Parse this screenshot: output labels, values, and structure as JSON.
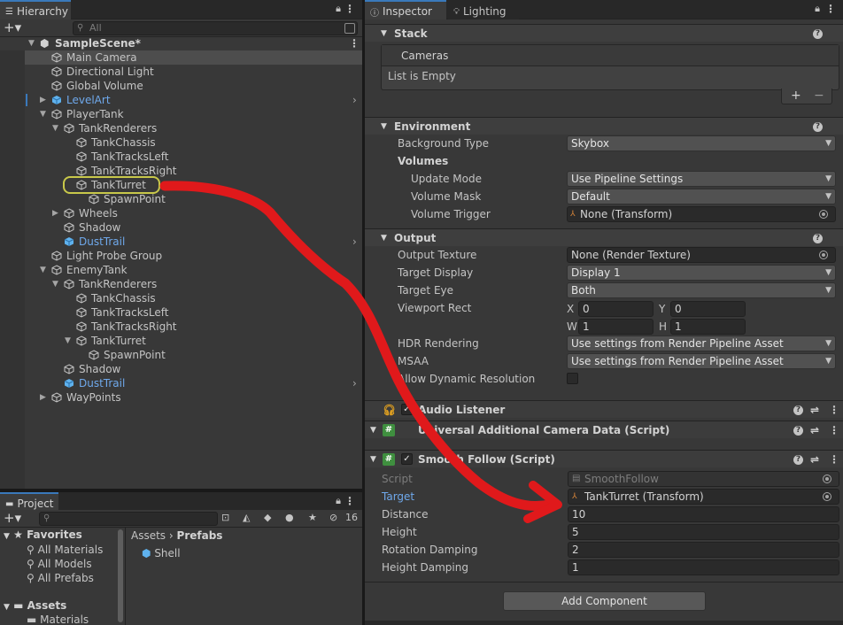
{
  "hierarchy": {
    "tab": "Hierarchy",
    "search_placeholder": "All",
    "scene": "SampleScene*",
    "rows": [
      {
        "label": "Main Camera",
        "depth": 1,
        "arrow": "",
        "blue": false,
        "selected": true
      },
      {
        "label": "Directional Light",
        "depth": 1,
        "arrow": "",
        "blue": false
      },
      {
        "label": "Global Volume",
        "depth": 1,
        "arrow": "",
        "blue": false
      },
      {
        "label": "LevelArt",
        "depth": 1,
        "arrow": "right",
        "blue": true,
        "more": true
      },
      {
        "label": "PlayerTank",
        "depth": 1,
        "arrow": "down",
        "blue": false
      },
      {
        "label": "TankRenderers",
        "depth": 2,
        "arrow": "down",
        "blue": false
      },
      {
        "label": "TankChassis",
        "depth": 3,
        "arrow": "",
        "blue": false
      },
      {
        "label": "TankTracksLeft",
        "depth": 3,
        "arrow": "",
        "blue": false
      },
      {
        "label": "TankTracksRight",
        "depth": 3,
        "arrow": "",
        "blue": false
      },
      {
        "label": "TankTurret",
        "depth": 3,
        "arrow": "",
        "blue": false,
        "circled": true
      },
      {
        "label": "SpawnPoint",
        "depth": 4,
        "arrow": "",
        "blue": false
      },
      {
        "label": "Wheels",
        "depth": 2,
        "arrow": "right",
        "blue": false
      },
      {
        "label": "Shadow",
        "depth": 2,
        "arrow": "",
        "blue": false
      },
      {
        "label": "DustTrail",
        "depth": 2,
        "arrow": "",
        "blue": true,
        "more": true
      },
      {
        "label": "Light Probe Group",
        "depth": 1,
        "arrow": "",
        "blue": false
      },
      {
        "label": "EnemyTank",
        "depth": 1,
        "arrow": "down",
        "blue": false
      },
      {
        "label": "TankRenderers",
        "depth": 2,
        "arrow": "down",
        "blue": false
      },
      {
        "label": "TankChassis",
        "depth": 3,
        "arrow": "",
        "blue": false
      },
      {
        "label": "TankTracksLeft",
        "depth": 3,
        "arrow": "",
        "blue": false
      },
      {
        "label": "TankTracksRight",
        "depth": 3,
        "arrow": "",
        "blue": false
      },
      {
        "label": "TankTurret",
        "depth": 3,
        "arrow": "down",
        "blue": false
      },
      {
        "label": "SpawnPoint",
        "depth": 4,
        "arrow": "",
        "blue": false
      },
      {
        "label": "Shadow",
        "depth": 2,
        "arrow": "",
        "blue": false
      },
      {
        "label": "DustTrail",
        "depth": 2,
        "arrow": "",
        "blue": true,
        "more": true
      },
      {
        "label": "WayPoints",
        "depth": 1,
        "arrow": "right",
        "blue": false
      }
    ]
  },
  "project": {
    "tab": "Project",
    "hidden_count": "16",
    "favorites": "Favorites",
    "fav_items": [
      "All Materials",
      "All Models",
      "All Prefabs"
    ],
    "assets": "Assets",
    "materials": "Materials",
    "breadcrumb_root": "Assets",
    "breadcrumb_sep": "›",
    "breadcrumb_current": "Prefabs",
    "asset_item": "Shell"
  },
  "inspector": {
    "tab_inspector": "Inspector",
    "tab_lighting": "Lighting",
    "stack": {
      "title": "Stack",
      "cameras": "Cameras",
      "empty": "List is Empty",
      "plus": "+",
      "minus": "−"
    },
    "environment": {
      "title": "Environment",
      "background_type_label": "Background Type",
      "background_type": "Skybox",
      "volumes": "Volumes",
      "update_mode_label": "Update Mode",
      "update_mode": "Use Pipeline Settings",
      "volume_mask_label": "Volume Mask",
      "volume_mask": "Default",
      "volume_trigger_label": "Volume Trigger",
      "volume_trigger": "None (Transform)"
    },
    "output": {
      "title": "Output",
      "output_texture_label": "Output Texture",
      "output_texture": "None (Render Texture)",
      "target_display_label": "Target Display",
      "target_display": "Display 1",
      "target_eye_label": "Target Eye",
      "target_eye": "Both",
      "viewport_label": "Viewport Rect",
      "vx_label": "X",
      "vx": "0",
      "vy_label": "Y",
      "vy": "0",
      "vw_label": "W",
      "vw": "1",
      "vh_label": "H",
      "vh": "1",
      "hdr_label": "HDR Rendering",
      "hdr": "Use settings from Render Pipeline Asset",
      "msaa_label": "MSAA",
      "msaa": "Use settings from Render Pipeline Asset",
      "dyn_label": "Allow Dynamic Resolution"
    },
    "audio_listener": "Audio Listener",
    "ucad": "Universal Additional Camera Data (Script)",
    "smooth_follow": {
      "title": "Smooth Follow (Script)",
      "script_label": "Script",
      "script": "SmoothFollow",
      "target_label": "Target",
      "target": "TankTurret (Transform)",
      "distance_label": "Distance",
      "distance": "10",
      "height_label": "Height",
      "height": "5",
      "rotation_damping_label": "Rotation Damping",
      "rotation_damping": "2",
      "height_damping_label": "Height Damping",
      "height_damping": "1"
    },
    "add_component": "Add Component"
  },
  "colors": {
    "annotation_red": "#e0191b",
    "circle_yellow": "#c8c84a",
    "accent_blue": "#3a79bb"
  }
}
